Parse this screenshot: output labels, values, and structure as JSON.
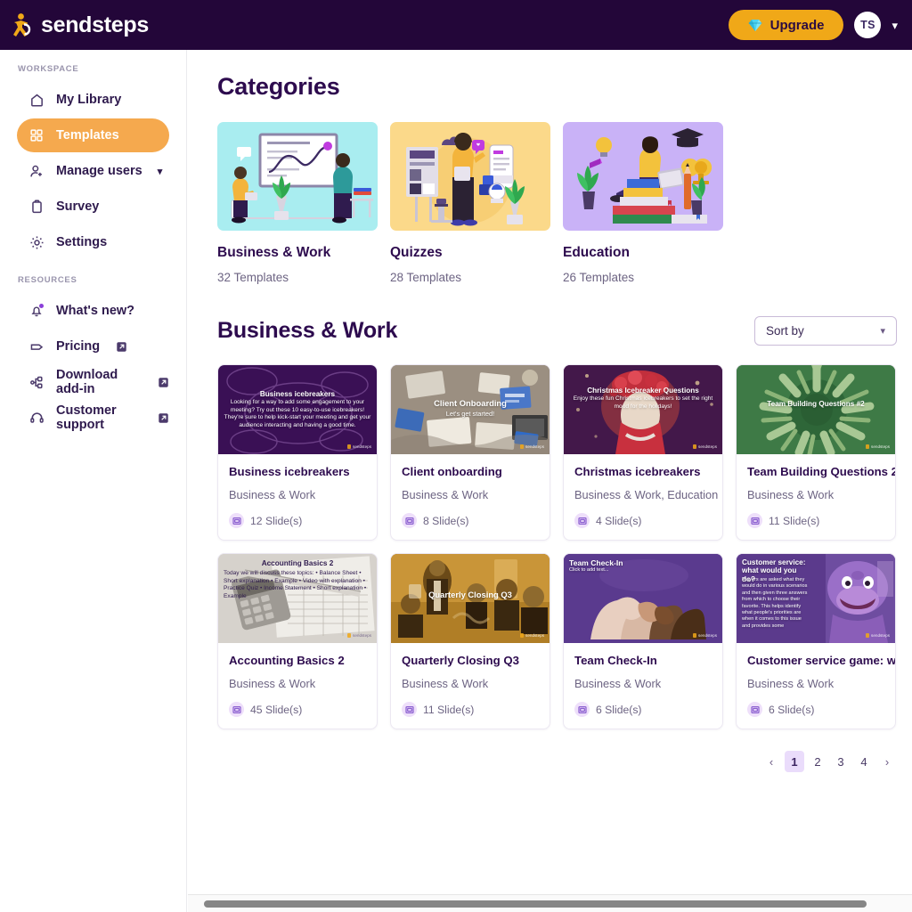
{
  "header": {
    "brand_name": "sendsteps",
    "upgrade_label": "Upgrade",
    "avatar_initials": "TS"
  },
  "sidebar": {
    "workspace_label": "WORKSPACE",
    "resources_label": "RESOURCES",
    "workspace_items": [
      {
        "label": "My Library",
        "icon": "home-icon",
        "active": false
      },
      {
        "label": "Templates",
        "icon": "grid-icon",
        "active": true
      },
      {
        "label": "Manage users",
        "icon": "user-plus-icon",
        "active": false,
        "chevron": "⌄"
      },
      {
        "label": "Survey",
        "icon": "clipboard-icon",
        "active": false
      },
      {
        "label": "Settings",
        "icon": "gear-icon",
        "active": false
      }
    ],
    "resources_items": [
      {
        "label": "What's new?",
        "icon": "bell-icon",
        "external": false,
        "badge": true
      },
      {
        "label": "Pricing",
        "icon": "tag-icon",
        "external": true
      },
      {
        "label": "Download add-in",
        "icon": "plugin-icon",
        "external": true
      },
      {
        "label": "Customer support",
        "icon": "headset-icon",
        "external": true
      }
    ]
  },
  "main": {
    "categories_title": "Categories",
    "categories": [
      {
        "name": "Business & Work",
        "count": "32 Templates",
        "bg": "#A9EDF0"
      },
      {
        "name": "Quizzes",
        "count": "28 Templates",
        "bg": "#FBD98A"
      },
      {
        "name": "Education",
        "count": "26 Templates",
        "bg": "#C9B2F7"
      }
    ],
    "section_title": "Business & Work",
    "sort_label": "Sort by",
    "templates": [
      {
        "title": "Business icebreakers",
        "category": "Business & Work",
        "slides": "12 Slide(s)",
        "thumb_title": "Business icebreakers",
        "thumb_sub": "Looking for a way to add some engagement to your meeting? Try out these 10 easy-to-use icebreakers! They're sure to help kick-start your meeting and get your audience interacting and having a good time.",
        "thumb_bg": "#3A1055"
      },
      {
        "title": "Client onboarding",
        "category": "Business & Work",
        "slides": "8 Slide(s)",
        "thumb_title": "Client Onboarding",
        "thumb_sub": "Let's get started!",
        "thumb_bg": "#9A8E82"
      },
      {
        "title": "Christmas icebreakers",
        "category": "Business & Work, Education",
        "slides": "4 Slide(s)",
        "thumb_title": "Christmas Icebreaker Questions",
        "thumb_sub": "Enjoy these fun Christmas icebreakers to set the right mood for the holidays!",
        "thumb_bg": "#4A1E4E"
      },
      {
        "title": "Team Building Questions 2",
        "category": "Business & Work",
        "slides": "11 Slide(s)",
        "thumb_title": "Team Building Questions #2",
        "thumb_sub": "",
        "thumb_bg": "#5E9E62"
      },
      {
        "title": "Accounting Basics 2",
        "category": "Business & Work",
        "slides": "45 Slide(s)",
        "thumb_title": "Accounting Basics 2",
        "thumb_sub": "Today we will discuss these topics: • Balance Sheet • Short explanation • Example • Video with explanation • Practice Quiz • Income Statement • Short explanation • Example",
        "thumb_bg": "#CFCBC6"
      },
      {
        "title": "Quarterly Closing Q3",
        "category": "Business & Work",
        "slides": "11 Slide(s)",
        "thumb_title": "Quarterly Closing Q3",
        "thumb_sub": "",
        "thumb_bg": "#C08A2E"
      },
      {
        "title": "Team Check-In",
        "category": "Business & Work",
        "slides": "6 Slide(s)",
        "thumb_title": "Team Check-In",
        "thumb_sub": "Click to add text...",
        "thumb_bg": "#5B3A8C"
      },
      {
        "title": "Customer service game: what would you do?",
        "category": "Business & Work",
        "slides": "6 Slide(s)",
        "thumb_title": "Customer service: what would you do?",
        "thumb_sub": "Players are asked what they would do in various scenarios and then given three answers from which to choose their favorite. This helps identify what people's priorities are when it comes to this issue and provides some",
        "thumb_bg": "#6B4A9E"
      }
    ],
    "pagination": {
      "prev": "‹",
      "next": "›",
      "pages": [
        "1",
        "2",
        "3",
        "4"
      ],
      "active_page": "1"
    }
  },
  "colors": {
    "header_bg": "#230639",
    "accent_orange": "#F5A94E",
    "upgrade_yellow": "#F0A818",
    "title_purple": "#2D0B4E",
    "muted_text": "#6D6483",
    "pager_active_bg": "#EADCFB"
  }
}
